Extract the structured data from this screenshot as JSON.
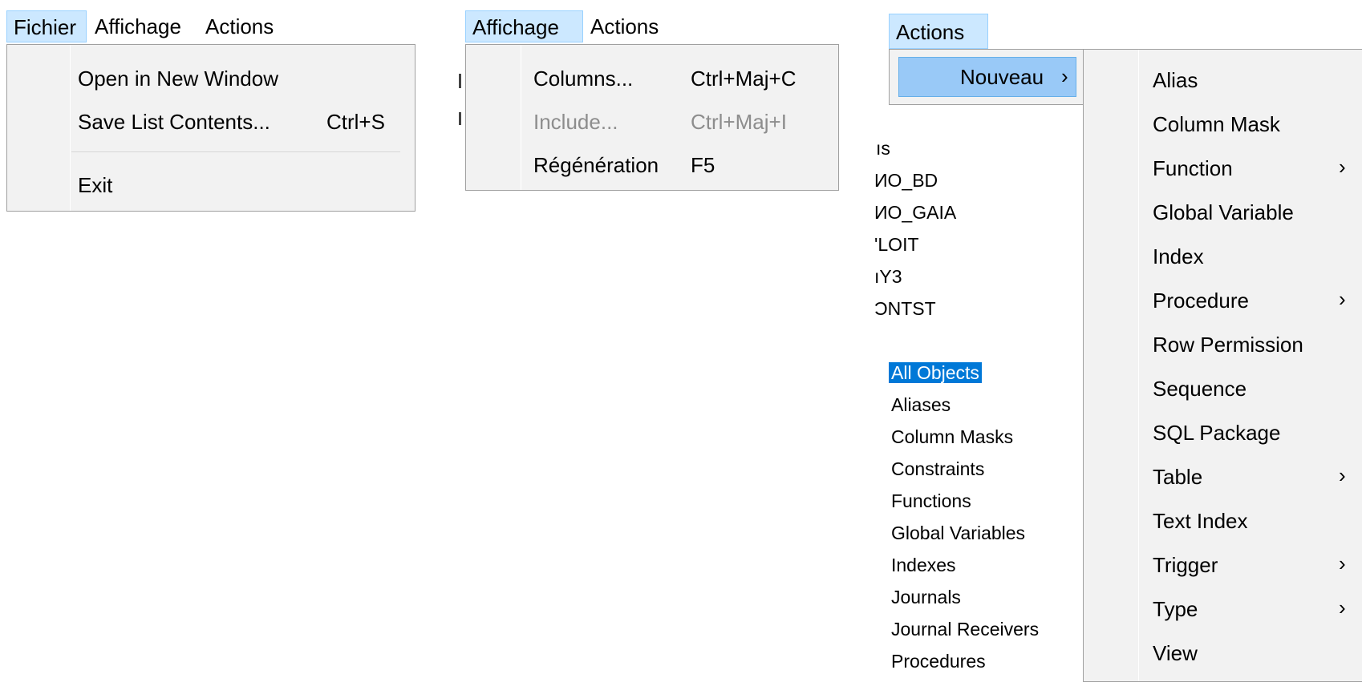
{
  "panel1": {
    "menubar": [
      "Fichier",
      "Affichage",
      "Actions"
    ],
    "menu": {
      "items": [
        {
          "label": "Open in New Window",
          "shortcut": ""
        },
        {
          "label": "Save List Contents...",
          "shortcut": "Ctrl+S"
        },
        {
          "label": "Exit",
          "shortcut": ""
        }
      ]
    }
  },
  "panel2": {
    "menubar": [
      "Affichage",
      "Actions"
    ],
    "menu": {
      "items": [
        {
          "label": "Columns...",
          "shortcut": "Ctrl+Maj+C",
          "disabled": false
        },
        {
          "label": "Include...",
          "shortcut": "Ctrl+Maj+I",
          "disabled": true
        },
        {
          "label": "Régénération",
          "shortcut": "F5",
          "disabled": false
        }
      ]
    }
  },
  "panel3": {
    "menubar": [
      "Actions"
    ],
    "menu": {
      "items": [
        {
          "label": "Nouveau",
          "submenu": true
        }
      ]
    },
    "submenu": {
      "items": [
        {
          "label": "Alias",
          "submenu": false
        },
        {
          "label": "Column Mask",
          "submenu": false
        },
        {
          "label": "Function",
          "submenu": true
        },
        {
          "label": "Global Variable",
          "submenu": false
        },
        {
          "label": "Index",
          "submenu": false
        },
        {
          "label": "Procedure",
          "submenu": true
        },
        {
          "label": "Row Permission",
          "submenu": false
        },
        {
          "label": "Sequence",
          "submenu": false
        },
        {
          "label": "SQL Package",
          "submenu": false
        },
        {
          "label": "Table",
          "submenu": true
        },
        {
          "label": "Text Index",
          "submenu": false
        },
        {
          "label": "Trigger",
          "submenu": true
        },
        {
          "label": "Type",
          "submenu": true
        },
        {
          "label": "View",
          "submenu": false
        }
      ]
    },
    "background_fragments": [
      "ıs",
      "ИO_BD",
      "ИO_GAIA",
      "'LOIT",
      "ıY3",
      "ƆNTST"
    ],
    "object_list": [
      "All Objects",
      "Aliases",
      "Column Masks",
      "Constraints",
      "Functions",
      "Global Variables",
      "Indexes",
      "Journals",
      "Journal Receivers",
      "Procedures"
    ],
    "selected_index": 0
  },
  "icons": {
    "submenu_arrow": "chevron-right-icon",
    "submenu_arrow_glyph": "›"
  },
  "colors": {
    "menu_bg": "#f2f2f2",
    "highlight": "#99c9f7",
    "selection": "#0078d7",
    "menubar_open": "#cce8ff"
  }
}
